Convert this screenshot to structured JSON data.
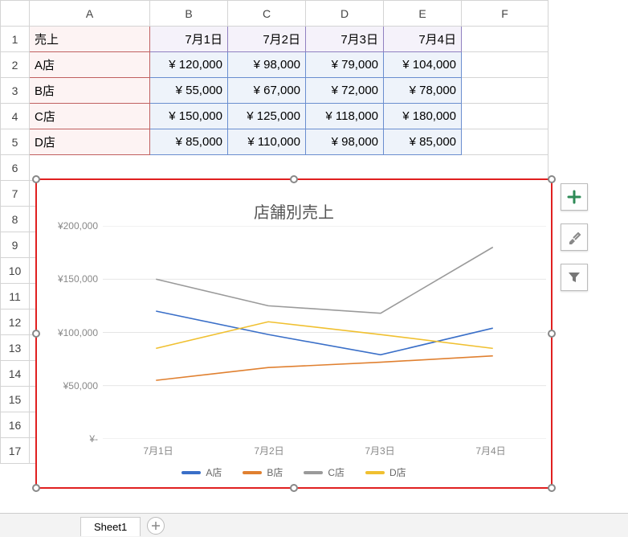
{
  "columns": [
    "A",
    "B",
    "C",
    "D",
    "E",
    "F"
  ],
  "row_numbers": [
    "1",
    "2",
    "3",
    "4",
    "5",
    "6",
    "7",
    "8",
    "9",
    "10",
    "11",
    "12",
    "13",
    "14",
    "15",
    "16",
    "17"
  ],
  "table": {
    "corner": "売上",
    "dates": [
      "7月1日",
      "7月2日",
      "7月3日",
      "7月4日"
    ],
    "stores": [
      "A店",
      "B店",
      "C店",
      "D店"
    ],
    "values_fmt": [
      [
        "¥ 120,000",
        "¥   98,000",
        "¥   79,000",
        "¥ 104,000"
      ],
      [
        "¥   55,000",
        "¥   67,000",
        "¥   72,000",
        "¥   78,000"
      ],
      [
        "¥ 150,000",
        "¥ 125,000",
        "¥ 118,000",
        "¥ 180,000"
      ],
      [
        "¥   85,000",
        "¥ 110,000",
        "¥   98,000",
        "¥   85,000"
      ]
    ]
  },
  "chart_data": {
    "type": "line",
    "title": "店舗別売上",
    "categories": [
      "7月1日",
      "7月2日",
      "7月3日",
      "7月4日"
    ],
    "series": [
      {
        "name": "A店",
        "color": "#3a6fc8",
        "values": [
          120000,
          98000,
          79000,
          104000
        ]
      },
      {
        "name": "B店",
        "color": "#e08030",
        "values": [
          55000,
          67000,
          72000,
          78000
        ]
      },
      {
        "name": "C店",
        "color": "#9a9a9a",
        "values": [
          150000,
          125000,
          118000,
          180000
        ]
      },
      {
        "name": "D店",
        "color": "#f0c030",
        "values": [
          85000,
          110000,
          98000,
          85000
        ]
      }
    ],
    "ylabel": "",
    "xlabel": "",
    "ylim": [
      0,
      200000
    ],
    "y_ticks": [
      "¥200,000",
      "¥150,000",
      "¥100,000",
      "¥50,000",
      "¥-"
    ]
  },
  "chart_buttons": {
    "plus": "+",
    "brush": "🖌",
    "filter": "⛉"
  },
  "tabs": {
    "active": "Sheet1"
  }
}
